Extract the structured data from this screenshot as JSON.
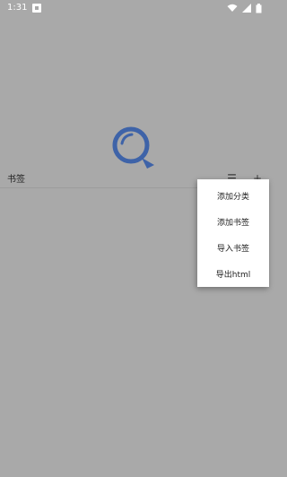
{
  "status_bar": {
    "time": "1:31"
  },
  "bookmark_bar": {
    "title": "书签",
    "menu_symbol": "☰",
    "add_symbol": "+"
  },
  "popup_menu": {
    "items": [
      {
        "label": "添加分类"
      },
      {
        "label": "添加书签"
      },
      {
        "label": "导入书签"
      },
      {
        "label": "导出html"
      }
    ]
  },
  "colors": {
    "overlay_background": "#a9a9a9",
    "logo_blue": "#3e63a8",
    "menu_background": "#ffffff"
  }
}
